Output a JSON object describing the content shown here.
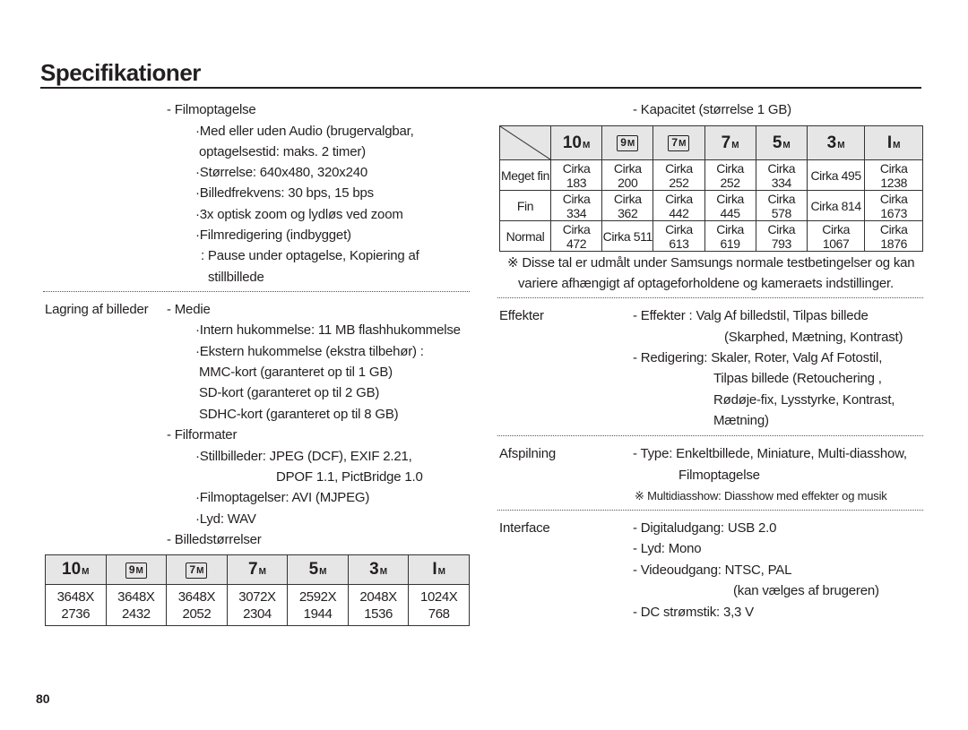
{
  "title": "Specifikationer",
  "page_number": "80",
  "left": {
    "film_heading": "- Filmoptagelse",
    "film_lines": [
      "·Med eller uden Audio (brugervalgbar,",
      "optagelsestid: maks. 2 timer)",
      "·Størrelse: 640x480, 320x240",
      "·Billedfrekvens: 30 bps, 15 bps",
      "·3x optisk zoom og lydløs ved zoom",
      "·Filmredigering (indbygget)",
      ": Pause under optagelse, Kopiering af",
      "stillbillede"
    ],
    "storage_label": "Lagring af billeder",
    "media_heading": "- Medie",
    "media_lines": [
      "·Intern hukommelse: 11 MB flashhukommelse",
      "·Ekstern hukommelse (ekstra tilbehør) :",
      "MMC-kort (garanteret op til 1 GB)",
      "SD-kort (garanteret op til 2 GB)",
      "SDHC-kort (garanteret op til 8 GB)"
    ],
    "format_heading": "- Filformater",
    "format_lines": [
      "·Stillbilleder: JPEG (DCF), EXIF 2.21,",
      "DPOF 1.1, PictBridge 1.0",
      "·Filmoptagelser: AVI (MJPEG)",
      "·Lyd: WAV"
    ],
    "sizes_heading": "- Billedstørrelser",
    "sizes_table": {
      "icons": [
        {
          "n": "10",
          "m": "M",
          "box": false
        },
        {
          "n": "9",
          "m": "M",
          "box": true
        },
        {
          "n": "7",
          "m": "M",
          "box": true
        },
        {
          "n": "7",
          "m": "M",
          "box": false
        },
        {
          "n": "5",
          "m": "M",
          "box": false
        },
        {
          "n": "3",
          "m": "M",
          "box": false
        },
        {
          "n": "I",
          "m": "M",
          "box": false
        }
      ],
      "widths": [
        "3648X",
        "3648X",
        "3648X",
        "3072X",
        "2592X",
        "2048X",
        "1024X"
      ],
      "heights": [
        "2736",
        "2432",
        "2052",
        "2304",
        "1944",
        "1536",
        "768"
      ]
    }
  },
  "right": {
    "capacity_heading": "- Kapacitet (størrelse 1 GB)",
    "capacity_table": {
      "rows": [
        {
          "label": "Meget fin",
          "values": [
            "Cirka 183",
            "Cirka 200",
            "Cirka 252",
            "Cirka 252",
            "Cirka 334",
            "Cirka 495",
            "Cirka 1238"
          ]
        },
        {
          "label": "Fin",
          "values": [
            "Cirka 334",
            "Cirka 362",
            "Cirka 442",
            "Cirka 445",
            "Cirka 578",
            "Cirka 814",
            "Cirka 1673"
          ]
        },
        {
          "label": "Normal",
          "values": [
            "Cirka 472",
            "Cirka 511",
            "Cirka 613",
            "Cirka 619",
            "Cirka 793",
            "Cirka 1067",
            "Cirka 1876"
          ]
        }
      ]
    },
    "note": [
      "※ Disse tal er udmålt under Samsungs normale testbetingelser og kan",
      "variere afhængigt af optageforholdene og kameraets indstillinger."
    ],
    "effects_label": "Effekter",
    "effects_lines": [
      "- Effekter : Valg Af billedstil, Tilpas billede",
      "(Skarphed, Mætning, Kontrast)",
      "- Redigering: Skaler, Roter, Valg Af Fotostil,",
      "Tilpas billede (Retouchering ,",
      "Rødøje-fix, Lysstyrke, Kontrast,",
      "Mætning)"
    ],
    "playback_label": "Afspilning",
    "playback_lines": [
      "- Type: Enkeltbillede, Miniature, Multi-diasshow,",
      "Filmoptagelse",
      "※ Multidiasshow: Diasshow med effekter og musik"
    ],
    "interface_label": "Interface",
    "interface_lines": [
      "- Digitaludgang: USB 2.0",
      "- Lyd: Mono",
      "- Videoudgang: NTSC, PAL",
      "(kan vælges af brugeren)",
      "- DC strømstik: 3,3 V"
    ]
  }
}
